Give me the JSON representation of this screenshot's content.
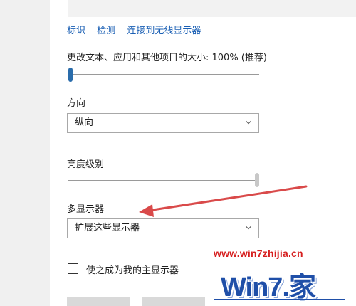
{
  "links": [
    "标识",
    "检测",
    "连接到无线显示器"
  ],
  "scale": {
    "label": "更改文本、应用和其他项目的大小: 100% (推荐)",
    "level": 0.0
  },
  "orientation": {
    "label": "方向",
    "value": "纵向"
  },
  "brightness": {
    "label": "亮度级别",
    "level": 1.0
  },
  "multi_display": {
    "label": "多显示器",
    "value": "扩展这些显示器"
  },
  "main_display": {
    "label": "使之成为我的主显示器",
    "checked": false
  },
  "watermark": {
    "url": "www.win7zhijia.cn",
    "brand": "Win7.家"
  },
  "colors": {
    "accent": "#2a6cab",
    "link": "#1a5fb4",
    "annotation_red": "#d94a4a",
    "watermark_red": "#d62020",
    "watermark_blue": "#1f4fa8"
  }
}
